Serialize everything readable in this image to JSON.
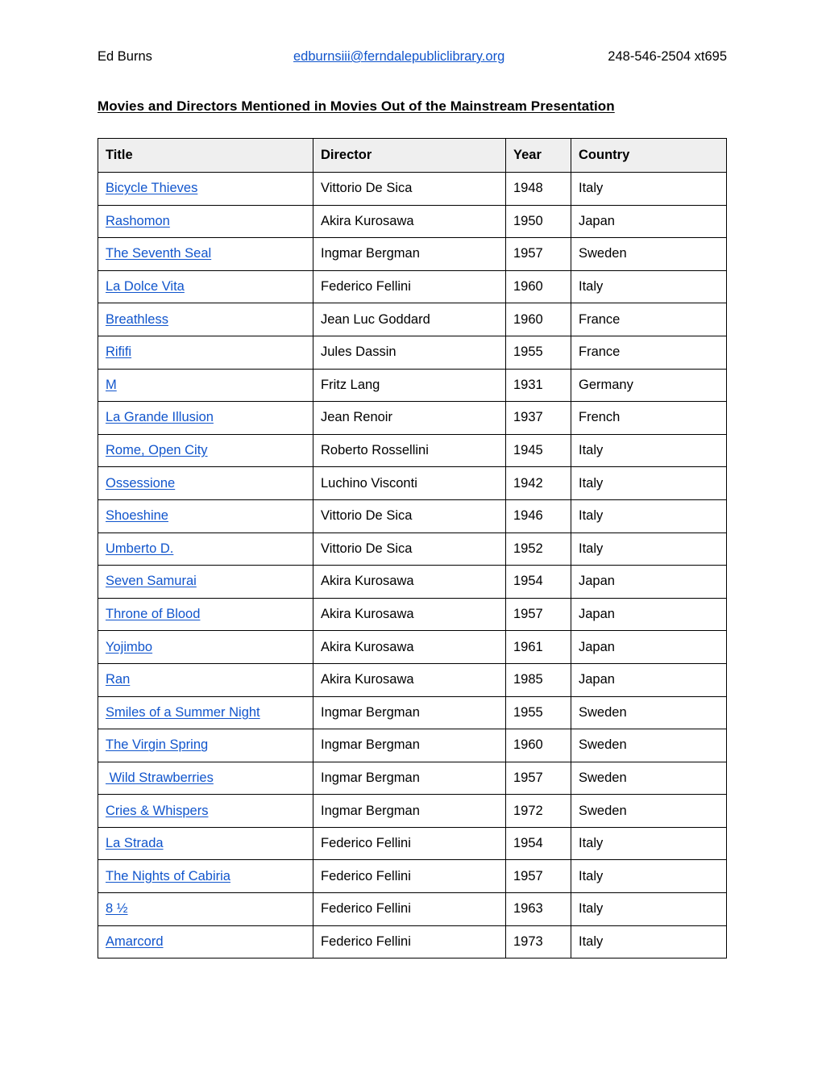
{
  "header": {
    "name": "Ed Burns",
    "email": "edburnsiii@ferndalepubliclibrary.org",
    "phone": "248-546-2504 xt695"
  },
  "title": "Movies and Directors Mentioned in Movies Out of the Mainstream Presentation",
  "colors": {
    "link": "#1155cc",
    "header_row_bg": "#efefef",
    "border": "#000000",
    "text": "#000000",
    "page_bg": "#ffffff"
  },
  "table": {
    "columns": [
      "Title",
      "Director",
      "Year",
      "Country"
    ],
    "rows": [
      {
        "title": "Bicycle Thieves",
        "director": "Vittorio De Sica",
        "year": "1948",
        "country": "Italy"
      },
      {
        "title": "Rashomon",
        "director": "Akira Kurosawa",
        "year": "1950",
        "country": "Japan"
      },
      {
        "title": "The Seventh Seal",
        "director": "Ingmar Bergman",
        "year": "1957",
        "country": "Sweden"
      },
      {
        "title": "La Dolce Vita",
        "director": "Federico Fellini",
        "year": "1960",
        "country": "Italy"
      },
      {
        "title": "Breathless",
        "director": "Jean Luc Goddard",
        "year": "1960",
        "country": "France"
      },
      {
        "title": "Rififi",
        "director": "Jules Dassin",
        "year": "1955",
        "country": "France"
      },
      {
        "title": "M",
        "director": "Fritz Lang",
        "year": "1931",
        "country": "Germany"
      },
      {
        "title": "La Grande Illusion",
        "director": "Jean Renoir",
        "year": "1937",
        "country": "French"
      },
      {
        "title": "Rome, Open City",
        "director": "Roberto Rossellini",
        "year": "1945",
        "country": "Italy"
      },
      {
        "title": "Ossessione",
        "director": "Luchino Visconti",
        "year": "1942",
        "country": "Italy"
      },
      {
        "title": "Shoeshine",
        "director": "Vittorio De Sica",
        "year": "1946",
        "country": "Italy"
      },
      {
        "title": "Umberto D.",
        "director": "Vittorio De Sica",
        "year": "1952",
        "country": "Italy"
      },
      {
        "title": "Seven Samurai",
        "director": "Akira Kurosawa",
        "year": "1954",
        "country": "Japan"
      },
      {
        "title": "Throne of Blood",
        "director": "Akira Kurosawa",
        "year": "1957",
        "country": "Japan"
      },
      {
        "title": "Yojimbo",
        "director": "Akira Kurosawa",
        "year": "1961",
        "country": "Japan"
      },
      {
        "title": "Ran",
        "director": "Akira Kurosawa",
        "year": "1985",
        "country": "Japan"
      },
      {
        "title": "Smiles of a Summer Night",
        "director": "Ingmar Bergman",
        "year": "1955",
        "country": "Sweden"
      },
      {
        "title": "The Virgin Spring",
        "director": "Ingmar Bergman",
        "year": "1960",
        "country": "Sweden"
      },
      {
        "title": " Wild Strawberries",
        "director": "Ingmar Bergman",
        "year": "1957",
        "country": "Sweden"
      },
      {
        "title": "Cries & Whispers",
        "director": "Ingmar Bergman",
        "year": "1972",
        "country": "Sweden"
      },
      {
        "title": "La Strada",
        "director": "Federico Fellini",
        "year": "1954",
        "country": "Italy"
      },
      {
        "title": "The Nights of Cabiria",
        "director": "Federico Fellini",
        "year": "1957",
        "country": "Italy"
      },
      {
        "title": "8 ½",
        "director": "Federico Fellini",
        "year": "1963",
        "country": "Italy"
      },
      {
        "title": "Amarcord",
        "director": "Federico Fellini",
        "year": "1973",
        "country": "Italy"
      }
    ]
  }
}
